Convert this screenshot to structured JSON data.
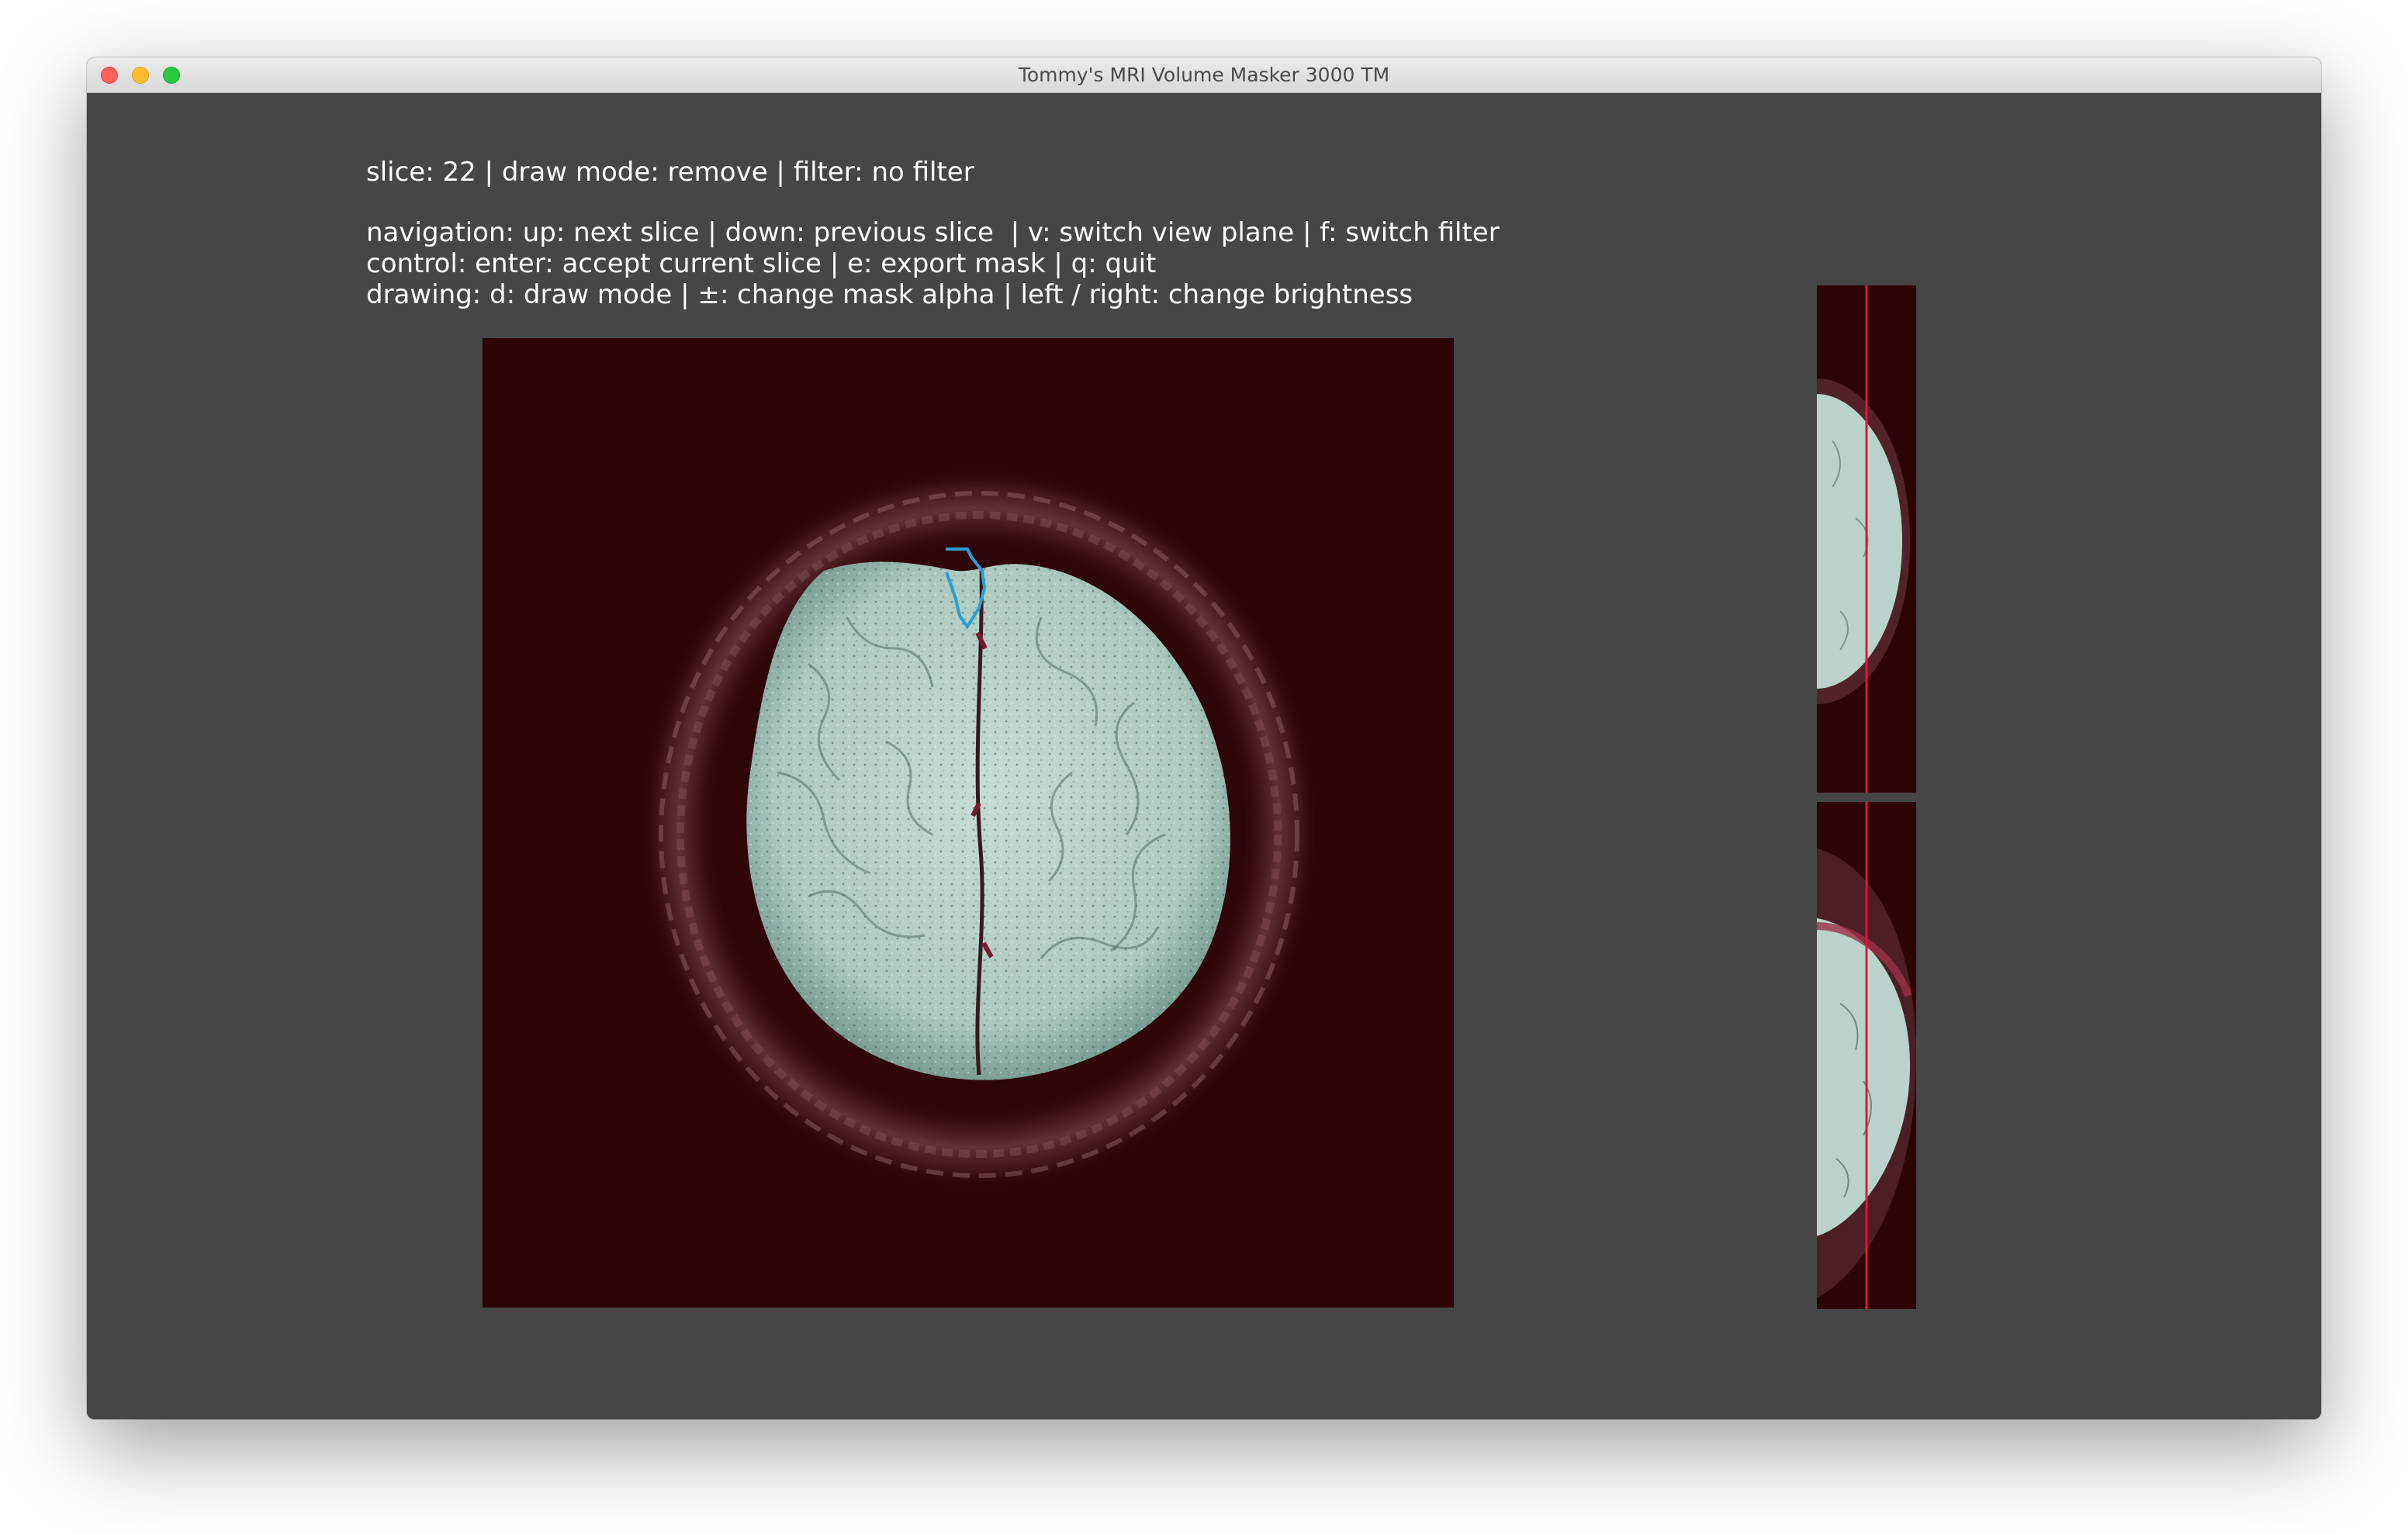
{
  "window": {
    "title": "Tommy's MRI Volume Masker 3000 TM"
  },
  "status": {
    "line": "slice: 22 | draw mode: remove | filter: no filter"
  },
  "help": {
    "navigation": "navigation: up: next slice | down: previous slice  | v: switch view plane | f: switch filter",
    "control": "control: enter: accept current slice | e: export mask | q: quit",
    "drawing": "drawing: d: draw mode | ±: change mask alpha | left / right: change brightness"
  },
  "colors": {
    "background": "#464646",
    "panel_background": "#2c0307",
    "tissue": "#b9d3cc",
    "contour": "#2a9fd6",
    "slice_marker": "#e8133c"
  }
}
